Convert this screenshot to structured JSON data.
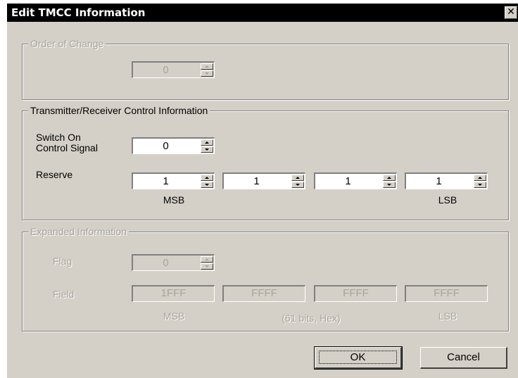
{
  "window": {
    "title": "Edit TMCC Information",
    "close_glyph": "✕"
  },
  "order_of_change": {
    "legend": "Order of Change",
    "value": "0"
  },
  "control": {
    "legend": "Transmitter/Receiver Control Information",
    "switch_label_line1": "Switch On",
    "switch_label_line2": "Control Signal",
    "switch_value": "0",
    "reserve_label": "Reserve",
    "reserve_values": [
      "1",
      "1",
      "1",
      "1"
    ],
    "msb_label": "MSB",
    "lsb_label": "LSB"
  },
  "expanded": {
    "legend": "Expanded Information",
    "flag_label": "Flag",
    "flag_value": "0",
    "field_label": "Field",
    "field_values": [
      "1FFF",
      "FFFF",
      "FFFF",
      "FFFF"
    ],
    "msb_label": "MSB",
    "note": "(61 bits, Hex)",
    "lsb_label": "LSB"
  },
  "buttons": {
    "ok": "OK",
    "cancel": "Cancel"
  }
}
